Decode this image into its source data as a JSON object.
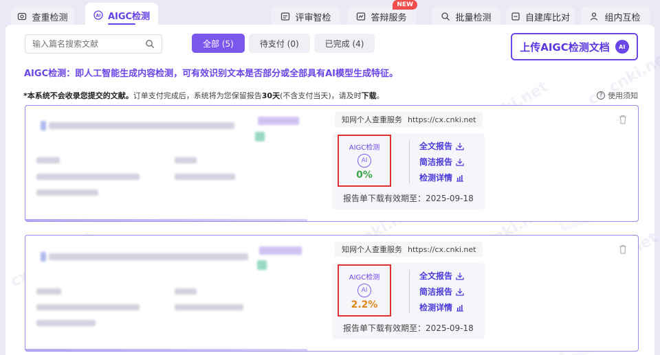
{
  "tabs": [
    {
      "label": "查重检测",
      "icon": "copy-check-icon"
    },
    {
      "label": "AIGC检测",
      "icon": "ai-icon",
      "active": true
    },
    {
      "label": "评审智检",
      "icon": "review-icon"
    },
    {
      "label": "答辩服务",
      "icon": "defense-icon",
      "badge": "NEW"
    },
    {
      "label": "批量检测",
      "icon": "batch-icon"
    },
    {
      "label": "自建库比对",
      "icon": "library-icon"
    },
    {
      "label": "组内互检",
      "icon": "group-icon"
    }
  ],
  "search": {
    "placeholder": "输入篇名搜索文献"
  },
  "filters": [
    {
      "label": "全部 (5)",
      "active": true
    },
    {
      "label": "待支付 (0)"
    },
    {
      "label": "已完成 (4)"
    }
  ],
  "upload": {
    "label": "上传AIGC检测文档",
    "badge": "AI"
  },
  "intro": "AIGC检测：即人工智能生成内容检测，可有效识别文本是否部分或全部具有AI模型生成特征。",
  "notice": {
    "prefix": "*本系统不会收录您提交的文献。",
    "middle": "订单支付完成后，系统将为您保留报告",
    "days": "30天",
    "suffix": "(不含支付当天)，请及时",
    "download": "下载",
    "end": "。"
  },
  "help": "使用须知",
  "records": [
    {
      "service": "知网个人查重服务",
      "url": "https://cx.cnki.net",
      "aigc_label": "AIGC检测",
      "ai_icon": "AI",
      "percent": "0%",
      "percent_color": "#3aa84a",
      "links": [
        "全文报告",
        "简洁报告",
        "检测详情"
      ],
      "expiry": "报告单下载有效期至：2025-09-18"
    },
    {
      "service": "知网个人查重服务",
      "url": "https://cx.cnki.net",
      "aigc_label": "AIGC检测",
      "ai_icon": "AI",
      "percent": "2.2%",
      "percent_color": "#e0871a",
      "links": [
        "全文报告",
        "简洁报告",
        "检测详情"
      ],
      "expiry": "报告单下载有效期至：2025-09-18"
    }
  ],
  "watermark": "cx.cnki.net",
  "colors": {
    "accent": "#6440e6",
    "alert": "#e03030",
    "link": "#4a3ad9"
  }
}
